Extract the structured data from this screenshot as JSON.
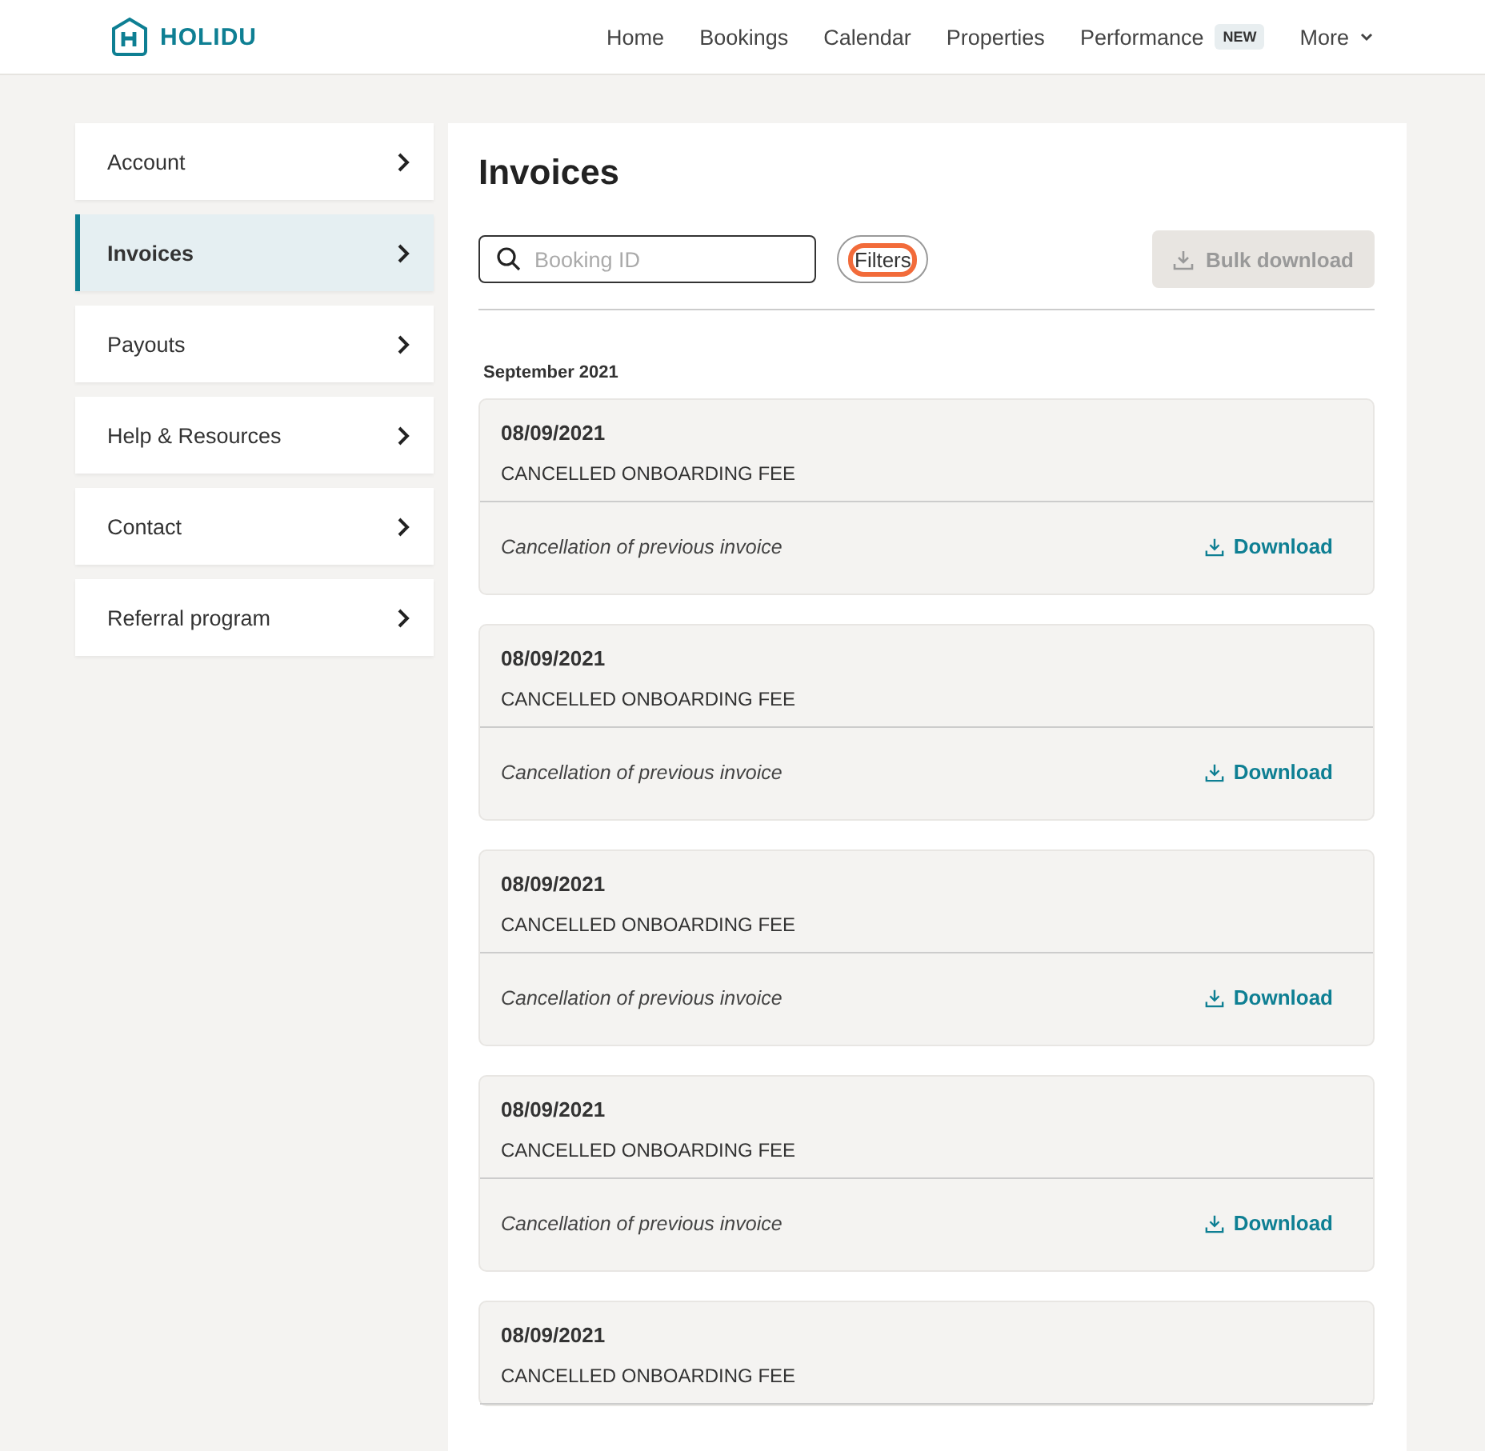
{
  "header": {
    "logo_text": "HOLIDU",
    "nav": [
      {
        "label": "Home"
      },
      {
        "label": "Bookings"
      },
      {
        "label": "Calendar"
      },
      {
        "label": "Properties"
      },
      {
        "label": "Performance",
        "badge": "NEW"
      },
      {
        "label": "More",
        "dropdown": true
      }
    ]
  },
  "sidebar": {
    "items": [
      {
        "label": "Account",
        "selected": false
      },
      {
        "label": "Invoices",
        "selected": true
      },
      {
        "label": "Payouts",
        "selected": false
      },
      {
        "label": "Help & Resources",
        "selected": false
      },
      {
        "label": "Contact",
        "selected": false
      },
      {
        "label": "Referral program",
        "selected": false
      }
    ]
  },
  "main": {
    "title": "Invoices",
    "search": {
      "placeholder": "Booking ID"
    },
    "filters": {
      "label": "Filters",
      "focused": true
    },
    "bulk_download": {
      "label": "Bulk download",
      "disabled": true
    },
    "groups": [
      {
        "heading": "September 2021",
        "invoices": [
          {
            "date": "08/09/2021",
            "title": "CANCELLED ONBOARDING FEE",
            "note": "Cancellation of previous invoice",
            "action": "Download"
          },
          {
            "date": "08/09/2021",
            "title": "CANCELLED ONBOARDING FEE",
            "note": "Cancellation of previous invoice",
            "action": "Download"
          },
          {
            "date": "08/09/2021",
            "title": "CANCELLED ONBOARDING FEE",
            "note": "Cancellation of previous invoice",
            "action": "Download"
          },
          {
            "date": "08/09/2021",
            "title": "CANCELLED ONBOARDING FEE",
            "note": "Cancellation of previous invoice",
            "action": "Download"
          },
          {
            "date": "08/09/2021",
            "title": "CANCELLED ONBOARDING FEE"
          }
        ]
      }
    ]
  }
}
